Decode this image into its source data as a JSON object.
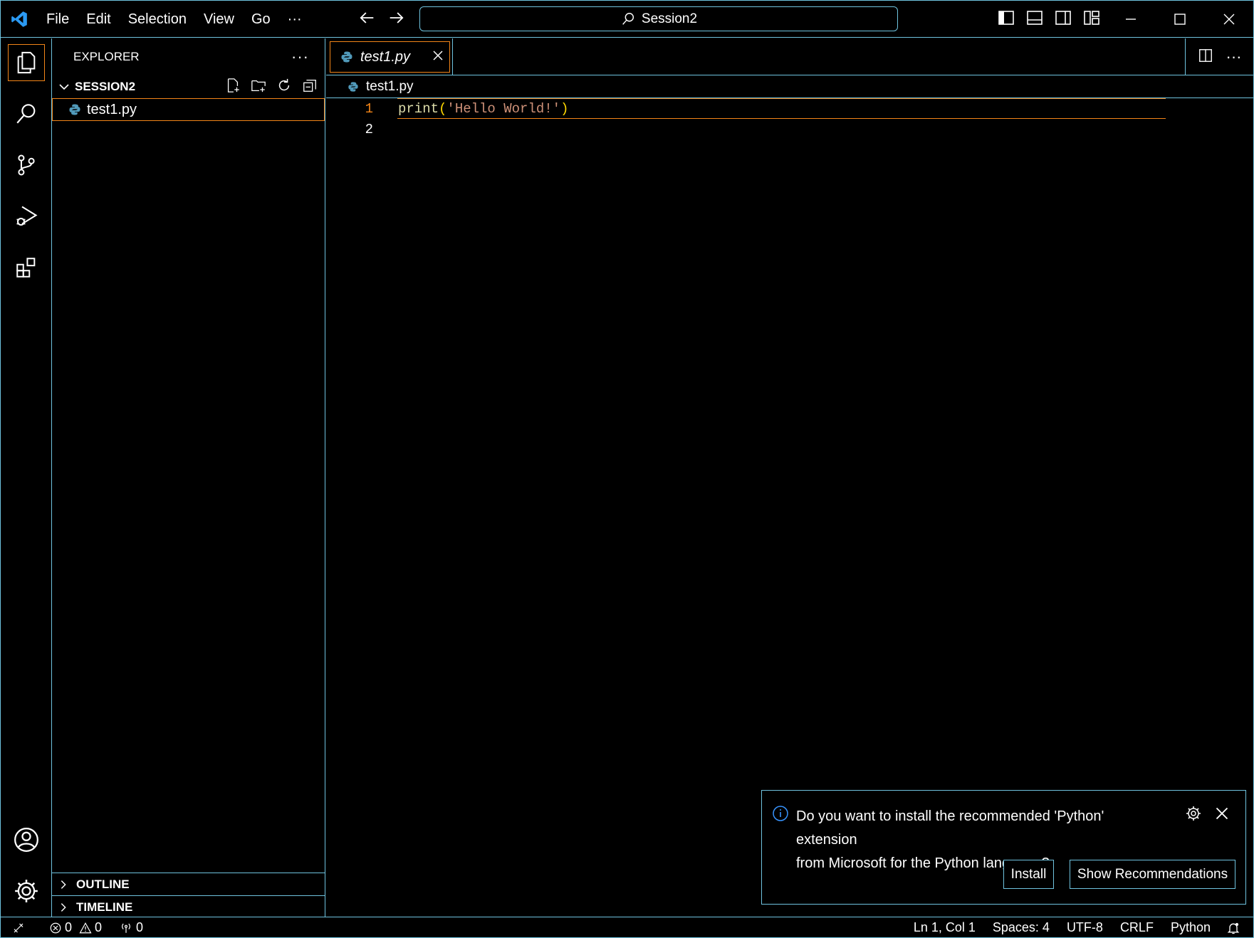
{
  "menu": [
    "File",
    "Edit",
    "Selection",
    "View",
    "Go",
    "···"
  ],
  "search": {
    "text": "Session2"
  },
  "sidebar": {
    "title": "EXPLORER",
    "folder": "SESSION2",
    "files": [
      "test1.py"
    ],
    "outline": "OUTLINE",
    "timeline": "TIMELINE"
  },
  "editor": {
    "tab": "test1.py",
    "breadcrumb": "test1.py",
    "lines": [
      {
        "num": "1",
        "fn": "print",
        "open": "(",
        "str": "'Hello World!'",
        "close": ")"
      },
      {
        "num": "2"
      }
    ]
  },
  "notification": {
    "message_line1": "Do you want to install the recommended 'Python' extension",
    "message_line2": "from Microsoft for the Python language?",
    "install": "Install",
    "show": "Show Recommendations"
  },
  "status": {
    "errors": "0",
    "warnings": "0",
    "ports": "0",
    "position": "Ln 1, Col 1",
    "spaces": "Spaces: 4",
    "encoding": "UTF-8",
    "eol": "CRLF",
    "language": "Python"
  },
  "colors": {
    "border": "#6fc3df",
    "active": "#f38518",
    "accent": "#007acc"
  }
}
